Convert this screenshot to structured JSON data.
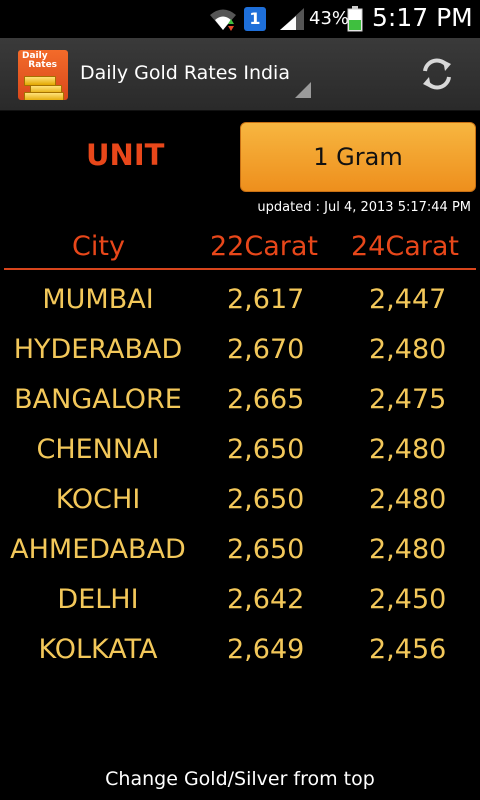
{
  "status_bar": {
    "notification_badge": "1",
    "battery_percent": "43%",
    "time": "5:17 PM"
  },
  "action_bar": {
    "app_icon_text": "Daily Rates",
    "title": "Daily Gold Rates India",
    "refresh_icon": "refresh-icon"
  },
  "unit": {
    "label": "UNIT",
    "selected": "1 Gram"
  },
  "updated": "updated : Jul 4, 2013 5:17:44 PM",
  "table": {
    "headers": [
      "City",
      "22Carat",
      "24Carat"
    ],
    "rows": [
      [
        "MUMBAI",
        "2,617",
        "2,447"
      ],
      [
        "HYDERABAD",
        "2,670",
        "2,480"
      ],
      [
        "BANGALORE",
        "2,665",
        "2,475"
      ],
      [
        "CHENNAI",
        "2,650",
        "2,480"
      ],
      [
        "KOCHI",
        "2,650",
        "2,480"
      ],
      [
        "AHMEDABAD",
        "2,650",
        "2,480"
      ],
      [
        "DELHI",
        "2,642",
        "2,450"
      ],
      [
        "KOLKATA",
        "2,649",
        "2,456"
      ]
    ]
  },
  "footer": "Change Gold/Silver from top",
  "colors": {
    "accent_red": "#e8471a",
    "value_gold": "#f3c85a",
    "button_orange": "#f0a030",
    "background": "#000000"
  }
}
